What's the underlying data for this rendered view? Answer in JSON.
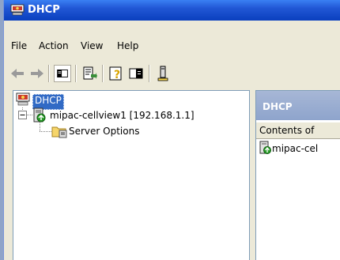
{
  "window": {
    "title": "DHCP"
  },
  "menu": {
    "file": "File",
    "action": "Action",
    "view": "View",
    "help": "Help"
  },
  "tree": {
    "root": "DHCP",
    "server": "mipac-cellview1 [192.168.1.1]",
    "options": "Server Options"
  },
  "right_pane": {
    "header": "DHCP",
    "column": "Contents of",
    "item": "mipac-cel"
  }
}
